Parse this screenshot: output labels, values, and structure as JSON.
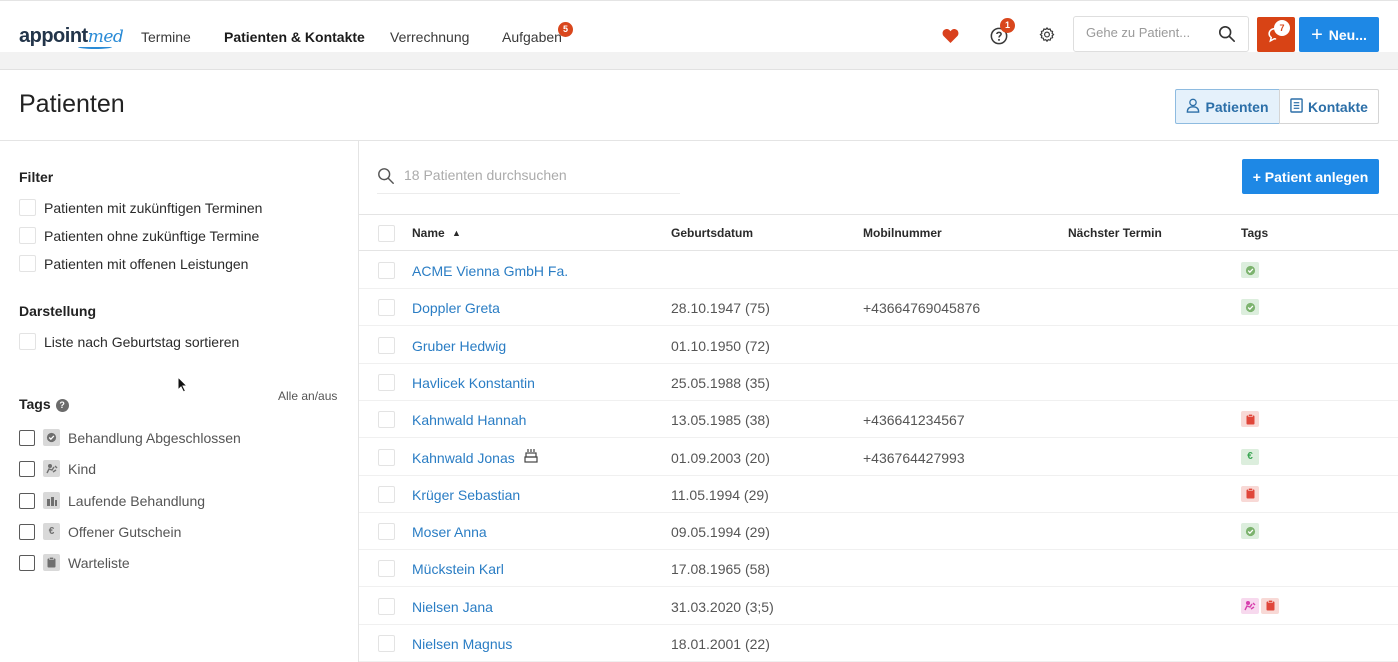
{
  "nav": {
    "logo_main": "appoint",
    "logo_accent": "med",
    "items": [
      "Termine",
      "Patienten & Kontakte",
      "Verrechnung",
      "Aufgaben"
    ],
    "tasks_badge": "5",
    "help_badge": "1",
    "chat_badge": "7",
    "search_placeholder": "Gehe zu Patient...",
    "new_button": "Neu..."
  },
  "header": {
    "title": "Patienten",
    "toggle_patients": "Patienten",
    "toggle_contacts": "Kontakte"
  },
  "sidebar": {
    "filter_heading": "Filter",
    "filters": [
      "Patienten mit zukünftigen Terminen",
      "Patienten ohne zukünftige Termine",
      "Patienten mit offenen Leistungen"
    ],
    "display_heading": "Darstellung",
    "display_option": "Liste nach Geburtstag sortieren",
    "tags_heading": "Tags",
    "tags_help": "?",
    "toggle_all": "Alle an/aus",
    "tags": [
      {
        "label": "Behandlung Abgeschlossen",
        "icon": "check-badge-icon"
      },
      {
        "label": "Kind",
        "icon": "child-icon"
      },
      {
        "label": "Laufende Behandlung",
        "icon": "treatment-icon"
      },
      {
        "label": "Offener Gutschein",
        "icon": "euro-icon"
      },
      {
        "label": "Warteliste",
        "icon": "clipboard-icon"
      }
    ]
  },
  "list": {
    "search_placeholder": "18 Patienten durchsuchen",
    "add_button": "+ Patient anlegen",
    "columns": {
      "name": "Name",
      "dob": "Geburtsdatum",
      "mobile": "Mobilnummer",
      "next": "Nächster Termin",
      "tags": "Tags"
    },
    "rows": [
      {
        "name": "ACME Vienna GmbH Fa.",
        "dob": "",
        "mobile": "",
        "tags": [
          "green"
        ]
      },
      {
        "name": "Doppler Greta",
        "dob": "28.10.1947 (75)",
        "mobile": "+43664769045876",
        "tags": [
          "green"
        ]
      },
      {
        "name": "Gruber Hedwig",
        "dob": "01.10.1950 (72)",
        "mobile": "",
        "tags": []
      },
      {
        "name": "Havlicek Konstantin",
        "dob": "25.05.1988 (35)",
        "mobile": "",
        "tags": []
      },
      {
        "name": "Kahnwald Hannah",
        "dob": "13.05.1985 (38)",
        "mobile": "+436641234567",
        "tags": [
          "red"
        ]
      },
      {
        "name": "Kahnwald Jonas",
        "dob": "01.09.2003 (20)",
        "mobile": "+436764427993",
        "tags": [
          "euro"
        ],
        "birthday": true
      },
      {
        "name": "Krüger Sebastian",
        "dob": "11.05.1994 (29)",
        "mobile": "",
        "tags": [
          "red"
        ]
      },
      {
        "name": "Moser Anna",
        "dob": "09.05.1994 (29)",
        "mobile": "",
        "tags": [
          "green"
        ]
      },
      {
        "name": "Mückstein Karl",
        "dob": "17.08.1965 (58)",
        "mobile": "",
        "tags": []
      },
      {
        "name": "Nielsen Jana",
        "dob": "31.03.2020 (3;5)",
        "mobile": "",
        "tags": [
          "pink",
          "red"
        ]
      },
      {
        "name": "Nielsen Magnus",
        "dob": "18.01.2001 (22)",
        "mobile": "",
        "tags": []
      }
    ]
  },
  "colors": {
    "primary": "#1e88e5",
    "danger": "#d84315",
    "link": "#2a7dc4"
  }
}
